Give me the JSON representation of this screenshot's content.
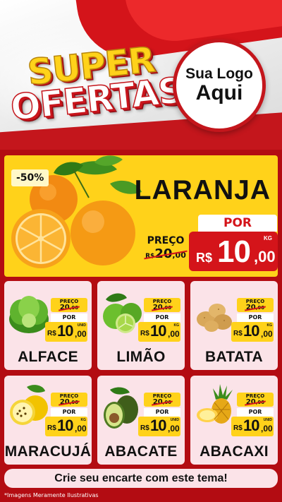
{
  "header": {
    "title_line1": "SUPER",
    "title_line2": "OFERTAS",
    "logo_line1": "Sua Logo",
    "logo_line2": "Aqui"
  },
  "featured": {
    "discount": "-50%",
    "name": "LARANJA",
    "preco_label": "PREÇO",
    "old_currency": "R$",
    "old_int": "20",
    "old_cents": ",00",
    "por_label": "POR",
    "currency": "R$",
    "price_int": "10",
    "price_cents": ",00",
    "unit": "KG"
  },
  "products": [
    {
      "name": "ALFACE",
      "preco_label": "PREÇO",
      "old_int": "20",
      "old_cents": ",00",
      "por_label": "POR",
      "currency": "R$",
      "price_int": "10",
      "price_cents": ",00",
      "unit": "UNID",
      "icon": "lettuce-icon"
    },
    {
      "name": "LIMÃO",
      "preco_label": "PREÇO",
      "old_int": "20",
      "old_cents": ",00",
      "por_label": "POR",
      "currency": "R$",
      "price_int": "10",
      "price_cents": ",00",
      "unit": "KG",
      "icon": "lime-icon"
    },
    {
      "name": "BATATA",
      "preco_label": "PREÇO",
      "old_int": "20",
      "old_cents": ",00",
      "por_label": "POR",
      "currency": "R$",
      "price_int": "10",
      "price_cents": ",00",
      "unit": "KG",
      "icon": "potato-icon"
    },
    {
      "name": "MARACUJÁ",
      "preco_label": "PREÇO",
      "old_int": "20",
      "old_cents": ",00",
      "por_label": "POR",
      "currency": "R$",
      "price_int": "10",
      "price_cents": ",00",
      "unit": "KG",
      "icon": "passion-fruit-icon"
    },
    {
      "name": "ABACATE",
      "preco_label": "PREÇO",
      "old_int": "20",
      "old_cents": ",00",
      "por_label": "POR",
      "currency": "R$",
      "price_int": "10",
      "price_cents": ",00",
      "unit": "UNID",
      "icon": "avocado-icon"
    },
    {
      "name": "ABACAXI",
      "preco_label": "PREÇO",
      "old_int": "20",
      "old_cents": ",00",
      "por_label": "POR",
      "currency": "R$",
      "price_int": "10",
      "price_cents": ",00",
      "unit": "UNID",
      "icon": "pineapple-icon"
    }
  ],
  "footer": {
    "cta": "Crie seu encarte com este tema!",
    "disclaimer": "*Imagens Meramente Ilustrativas"
  },
  "colors": {
    "brand_red": "#c4161c",
    "accent_yellow": "#ffd21a",
    "card_pink": "#fbe3e8"
  }
}
